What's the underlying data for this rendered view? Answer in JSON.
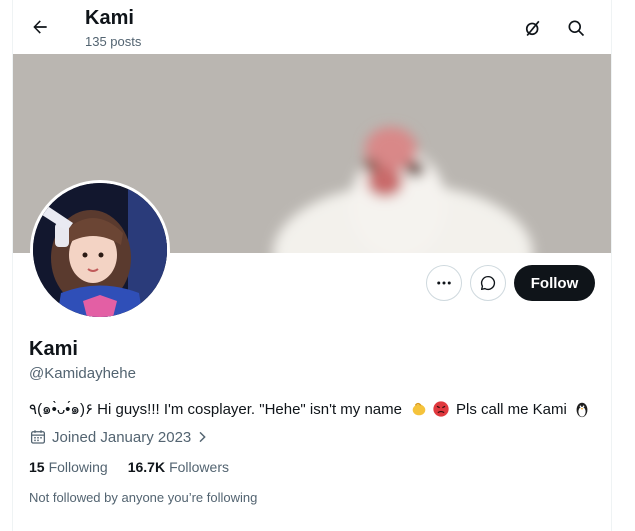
{
  "header": {
    "title": "Kami",
    "post_count": "135 posts"
  },
  "profile": {
    "display_name": "Kami",
    "handle": "@Kamidayhehe",
    "bio_prefix": "٩(๑•̀ᴗ•́๑)۶ Hi guys!!! I'm cosplayer. \"Hehe\" isn't my name",
    "bio_suffix": "Pls call me Kami",
    "joined": "Joined January 2023",
    "following_count": "15",
    "following_label": "Following",
    "followers_count": "16.7K",
    "followers_label": "Followers",
    "not_followed_text": "Not followed by anyone you’re following"
  },
  "buttons": {
    "follow_label": "Follow"
  },
  "icons": {
    "back": "arrow-left-icon",
    "grok": "grok-icon",
    "search": "search-icon",
    "more": "more-horizontal-icon",
    "message": "message-bubble-icon",
    "calendar": "calendar-icon",
    "chevron": "chevron-right-icon"
  },
  "colors": {
    "text_primary": "#0f1419",
    "text_secondary": "#536471",
    "follow_bg": "#0f1419",
    "border": "#cfd9de"
  }
}
